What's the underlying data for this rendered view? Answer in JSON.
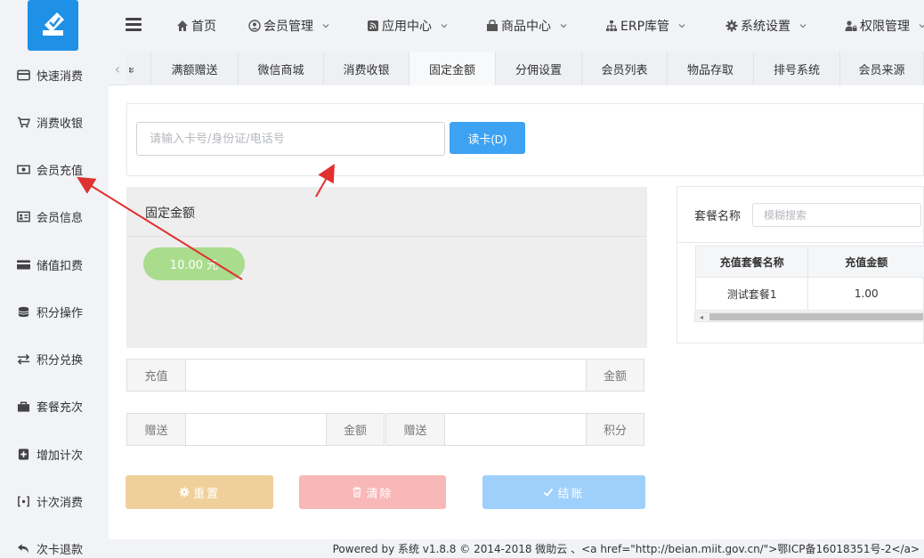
{
  "sidebar": {
    "items": [
      {
        "label": "快速消费",
        "icon": "card-icon"
      },
      {
        "label": "消费收银",
        "icon": "cart-icon"
      },
      {
        "label": "会员充值",
        "icon": "money-icon"
      },
      {
        "label": "会员信息",
        "icon": "id-card-icon"
      },
      {
        "label": "储值扣费",
        "icon": "credit-card-icon"
      },
      {
        "label": "积分操作",
        "icon": "database-icon"
      },
      {
        "label": "积分兑换",
        "icon": "exchange-icon"
      },
      {
        "label": "套餐充次",
        "icon": "bag-icon"
      },
      {
        "label": "增加计次",
        "icon": "plus-square-icon"
      },
      {
        "label": "计次消费",
        "icon": "bracket-icon"
      },
      {
        "label": "次卡退款",
        "icon": "undo-icon"
      }
    ]
  },
  "topnav": {
    "items": [
      {
        "label": "首页",
        "icon": "home-icon",
        "dropdown": false
      },
      {
        "label": "会员管理",
        "icon": "user-circle-icon",
        "dropdown": true
      },
      {
        "label": "应用中心",
        "icon": "rss-icon",
        "dropdown": true
      },
      {
        "label": "商品中心",
        "icon": "shopping-bag-icon",
        "dropdown": true
      },
      {
        "label": "ERP库管",
        "icon": "sitemap-icon",
        "dropdown": true
      },
      {
        "label": "系统设置",
        "icon": "gear-icon",
        "dropdown": true
      },
      {
        "label": "权限管理",
        "icon": "user-lock-icon",
        "dropdown": true
      }
    ]
  },
  "tabs": {
    "prev_glyph": "‹",
    "partial_glyph": "ะ",
    "items": [
      "满额赠送",
      "微信商城",
      "消费收银",
      "固定金额",
      "分佣设置",
      "会员列表",
      "物品存取",
      "排号系统",
      "会员来源"
    ]
  },
  "search": {
    "placeholder": "请输入卡号/身份证/电话号",
    "value": "",
    "read_button": "读卡(D)"
  },
  "fixed_amount": {
    "title": "固定金额",
    "pill": "10.00 元"
  },
  "recharge_row": {
    "left_addon": "充值",
    "right_addon": "金额"
  },
  "gift_row": {
    "left_addon_1": "赠送",
    "right_addon_1": "金额",
    "left_addon_2": "赠送",
    "right_addon_2": "积分"
  },
  "buttons": {
    "reset": "重置",
    "clear": "清除",
    "checkout": "结账"
  },
  "package": {
    "label": "套餐名称",
    "search_placeholder": "模糊搜索",
    "columns": [
      "充值套餐名称",
      "充值金额"
    ],
    "rows": [
      [
        "测试套餐1",
        "1.00"
      ]
    ]
  },
  "footer": {
    "text": "Powered by 系统 v1.8.8 © 2014-2018 微助云 、<a href=\"http://beian.miit.gov.cn/\">鄂ICP备16018351号-2</a>"
  },
  "colors": {
    "accent": "#3ea2f2",
    "reset": "#f0d09a",
    "clear": "#f8b8b8",
    "checkout": "#9fd0fb",
    "pill": "#a9dc8d",
    "arrow": "#e03030"
  }
}
